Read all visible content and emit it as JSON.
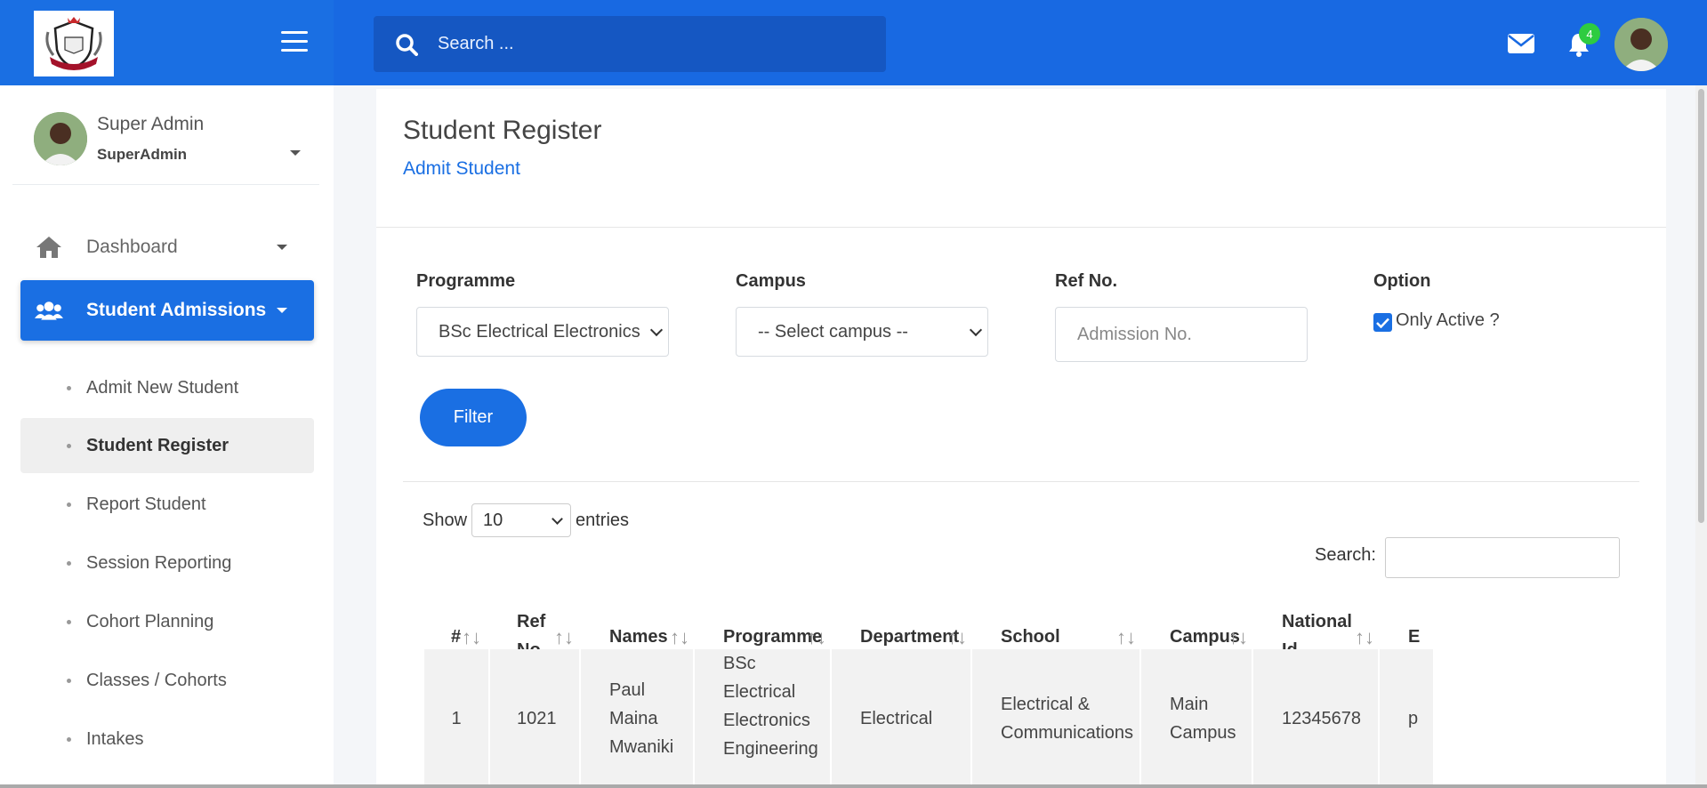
{
  "header": {
    "search_placeholder": "Search ...",
    "notification_count": "4"
  },
  "user": {
    "name": "Super Admin",
    "role": "SuperAdmin"
  },
  "sidebar": {
    "items": [
      {
        "label": "Dashboard"
      },
      {
        "label": "Student Admissions"
      }
    ],
    "subitems": [
      {
        "label": "Admit New Student"
      },
      {
        "label": "Student Register"
      },
      {
        "label": "Report Student"
      },
      {
        "label": "Session Reporting"
      },
      {
        "label": "Cohort Planning"
      },
      {
        "label": "Classes / Cohorts"
      },
      {
        "label": "Intakes"
      }
    ]
  },
  "page": {
    "title": "Student Register",
    "admit_link": "Admit Student"
  },
  "filters": {
    "programme_label": "Programme",
    "programme_value": "BSc Electrical Electronics",
    "campus_label": "Campus",
    "campus_value": "-- Select campus --",
    "ref_label": "Ref No.",
    "ref_placeholder": "Admission No.",
    "option_label": "Option",
    "only_active_label": "Only Active ?",
    "filter_button": "Filter"
  },
  "table_controls": {
    "show_label": "Show",
    "page_length": "10",
    "entries_label": "entries",
    "search_label": "Search:"
  },
  "table": {
    "headers": [
      "#",
      "Ref No.",
      "Names",
      "Programme",
      "Department",
      "School",
      "Campus",
      "National Id",
      "E"
    ],
    "rows": [
      [
        "1",
        "1021",
        "Paul Maina Mwaniki",
        "BSc Electrical Electronics Engineering",
        "Electrical",
        "Electrical & Communications",
        "Main Campus",
        "12345678",
        "p"
      ]
    ]
  },
  "colors": {
    "primary": "#1a6fe3",
    "topbar": "#1869e2",
    "badge": "#2ecc40"
  }
}
